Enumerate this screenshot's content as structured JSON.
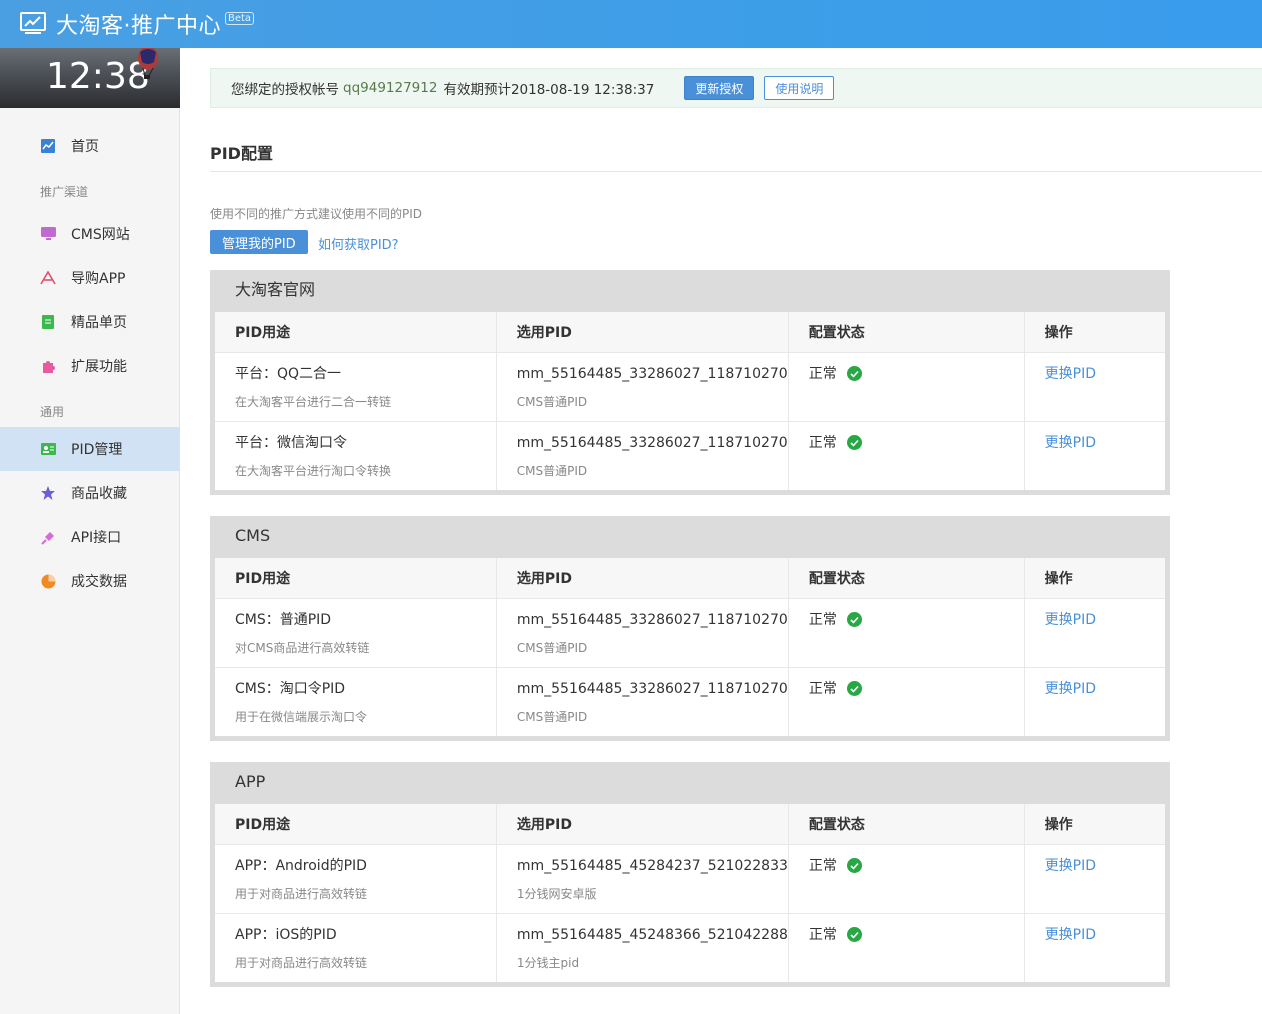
{
  "header": {
    "title": "大淘客·推广中心",
    "badge": "Beta"
  },
  "sidebar": {
    "clock": "12:38",
    "items": [
      {
        "label": "首页",
        "icon": "chart-icon",
        "color": "#3b82d6"
      },
      {
        "group": "推广渠道"
      },
      {
        "label": "CMS网站",
        "icon": "monitor-icon",
        "color": "#c06ad0"
      },
      {
        "label": "导购APP",
        "icon": "app-icon",
        "color": "#e0506a"
      },
      {
        "label": "精品单页",
        "icon": "document-icon",
        "color": "#3cb94c"
      },
      {
        "label": "扩展功能",
        "icon": "puzzle-icon",
        "color": "#e85aa0"
      },
      {
        "group": "通用"
      },
      {
        "label": "PID管理",
        "icon": "id-card-icon",
        "color": "#3cb94c",
        "active": true
      },
      {
        "label": "商品收藏",
        "icon": "star-icon",
        "color": "#6a5fd8"
      },
      {
        "label": "API接口",
        "icon": "plug-icon",
        "color": "#d66ad6"
      },
      {
        "label": "成交数据",
        "icon": "pie-icon",
        "color": "#f08a24"
      }
    ]
  },
  "auth": {
    "prefix": "您绑定的授权帐号",
    "account": "qq949127912",
    "expiry": "有效期预计2018-08-19 12:38:37",
    "renew_label": "更新授权",
    "help_label": "使用说明"
  },
  "pid_section": {
    "title": "PID配置",
    "hint": "使用不同的推广方式建议使用不同的PID",
    "manage_label": "管理我的PID",
    "howto_label": "如何获取PID?"
  },
  "columns": [
    "PID用途",
    "选用PID",
    "配置状态",
    "操作"
  ],
  "panels": [
    {
      "title": "大淘客官网",
      "rows": [
        {
          "name": "平台：QQ二合一",
          "desc": "在大淘客平台进行二合一转链",
          "pid": "mm_55164485_33286027_118710270",
          "pid_note": "CMS普通PID",
          "status": "正常",
          "action": "更换PID"
        },
        {
          "name": "平台：微信淘口令",
          "desc": "在大淘客平台进行淘口令转换",
          "pid": "mm_55164485_33286027_118710270",
          "pid_note": "CMS普通PID",
          "status": "正常",
          "action": "更换PID"
        }
      ]
    },
    {
      "title": "CMS",
      "rows": [
        {
          "name": "CMS：普通PID",
          "desc": "对CMS商品进行高效转链",
          "pid": "mm_55164485_33286027_118710270",
          "pid_note": "CMS普通PID",
          "status": "正常",
          "action": "更换PID"
        },
        {
          "name": "CMS：淘口令PID",
          "desc": "用于在微信端展示淘口令",
          "pid": "mm_55164485_33286027_118710270",
          "pid_note": "CMS普通PID",
          "status": "正常",
          "action": "更换PID"
        }
      ]
    },
    {
      "title": "APP",
      "rows": [
        {
          "name": "APP：Android的PID",
          "desc": "用于对商品进行高效转链",
          "pid": "mm_55164485_45284237_521022833",
          "pid_note": "1分钱网安卓版",
          "status": "正常",
          "action": "更换PID"
        },
        {
          "name": "APP：iOS的PID",
          "desc": "用于对商品进行高效转链",
          "pid": "mm_55164485_45248366_521042288",
          "pid_note": "1分钱主pid",
          "status": "正常",
          "action": "更换PID"
        }
      ]
    }
  ],
  "colors": {
    "header": "#3d9ee8",
    "link": "#4a90d9",
    "ok": "#27a844",
    "active_bg": "#d0e2f3"
  }
}
